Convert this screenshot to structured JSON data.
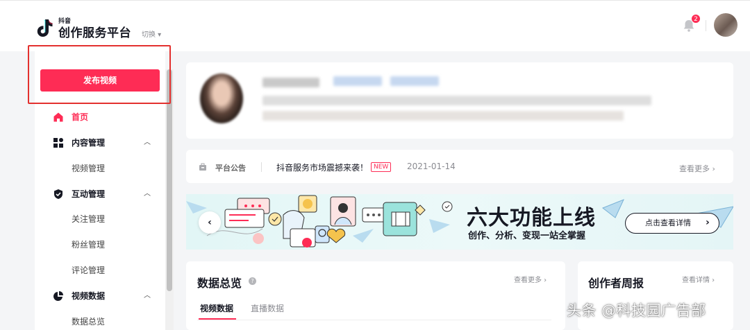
{
  "header": {
    "logo_small": "抖音",
    "logo_title": "创作服务平台",
    "switch_label": "切换 ▾",
    "notification_count": "2"
  },
  "sidebar": {
    "publish_button": "发布视频",
    "items": [
      {
        "label": "首页",
        "icon": "home-icon",
        "active": true
      },
      {
        "label": "内容管理",
        "icon": "grid-icon",
        "expanded": true,
        "children": [
          "视频管理"
        ]
      },
      {
        "label": "互动管理",
        "icon": "shield-icon",
        "expanded": true,
        "children": [
          "关注管理",
          "粉丝管理",
          "评论管理"
        ]
      },
      {
        "label": "视频数据",
        "icon": "pie-chart-icon",
        "expanded": true,
        "children": [
          "数据总览"
        ]
      }
    ]
  },
  "announcement": {
    "label": "平台公告",
    "text": "抖音服务市场震撼来袭！",
    "badge": "NEW",
    "date": "2021-01-14",
    "more": "查看更多"
  },
  "banner": {
    "title": "六大功能上线",
    "subtitle": "创作、分析、变现一站全掌握",
    "cta": "点击查看详情",
    "prev_icon": "chevron-left-icon",
    "next_icon": "chevron-right-icon"
  },
  "data_overview": {
    "title": "数据总览",
    "more": "查看更多",
    "tabs": [
      "视频数据",
      "直播数据"
    ],
    "active_tab": "视频数据"
  },
  "weekly_report": {
    "title": "创作者周报",
    "more": "查看详情"
  },
  "watermark": "头条 @科技园广告部",
  "colors": {
    "accent": "#fe2c55",
    "highlight_box": "#e3302e",
    "background": "#f4f5f7"
  }
}
